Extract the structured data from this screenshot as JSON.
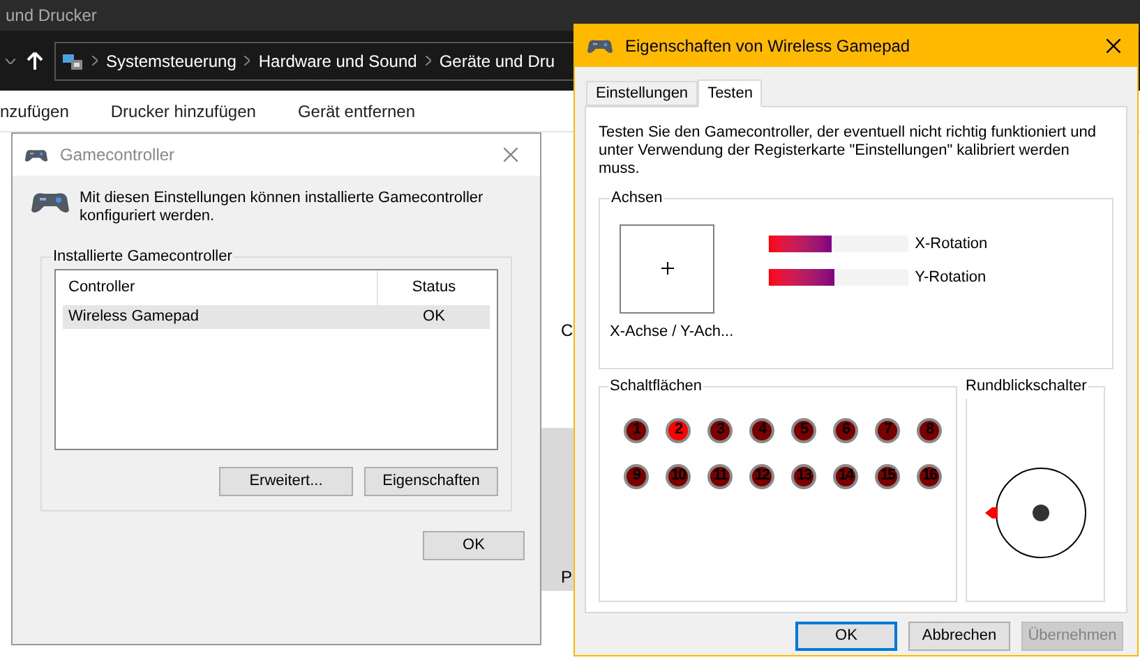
{
  "explorer": {
    "title": "und Drucker",
    "breadcrumb": [
      "Systemsteuerung",
      "Hardware und Sound",
      "Geräte und Dru"
    ],
    "toolbar": [
      "nzufügen",
      "Drucker hinzufügen",
      "Gerät entfernen"
    ],
    "right_fragments": [
      "C",
      "P"
    ]
  },
  "gamecontroller_dialog": {
    "title": "Gamecontroller",
    "intro": "Mit diesen Einstellungen können installierte Gamecontroller konfiguriert werden.",
    "group_label": "Installierte Gamecontroller",
    "columns": [
      "Controller",
      "Status"
    ],
    "rows": [
      {
        "controller": "Wireless Gamepad",
        "status": "OK",
        "selected": true
      }
    ],
    "buttons": [
      "Erweitert...",
      "Eigenschaften"
    ],
    "ok": "OK"
  },
  "properties_dialog": {
    "title": "Eigenschaften von Wireless Gamepad",
    "tabs": [
      {
        "label": "Einstellungen",
        "selected": false
      },
      {
        "label": "Testen",
        "selected": true
      }
    ],
    "description": "Testen Sie den Gamecontroller, der eventuell nicht richtig funktioniert und unter Verwendung der Registerkarte \"Einstellungen\" kalibriert werden muss.",
    "axes_label": "Achsen",
    "xy_label": "X-Achse / Y-Ach...",
    "rotations": [
      {
        "label": "X-Rotation",
        "level": 0.45
      },
      {
        "label": "Y-Rotation",
        "level": 0.47
      }
    ],
    "buttons_label": "Schaltflächen",
    "buttons": [
      {
        "label": "1",
        "pressed": false
      },
      {
        "label": "2",
        "pressed": true
      },
      {
        "label": "3",
        "pressed": false
      },
      {
        "label": "4",
        "pressed": false
      },
      {
        "label": "5",
        "pressed": false
      },
      {
        "label": "6",
        "pressed": false
      },
      {
        "label": "7",
        "pressed": false
      },
      {
        "label": "8",
        "pressed": false
      },
      {
        "label": "9",
        "pressed": false
      },
      {
        "label": "10",
        "pressed": false
      },
      {
        "label": "11",
        "pressed": false
      },
      {
        "label": "12",
        "pressed": false
      },
      {
        "label": "13",
        "pressed": false
      },
      {
        "label": "14",
        "pressed": false
      },
      {
        "label": "15",
        "pressed": false
      },
      {
        "label": "16",
        "pressed": false
      }
    ],
    "pov_label": "Rundblickschalter",
    "actions": [
      {
        "label": "OK",
        "kind": "default",
        "disabled": false
      },
      {
        "label": "Abbrechen",
        "kind": "normal",
        "disabled": false
      },
      {
        "label": "Übernehmen",
        "kind": "normal",
        "disabled": true
      }
    ]
  }
}
